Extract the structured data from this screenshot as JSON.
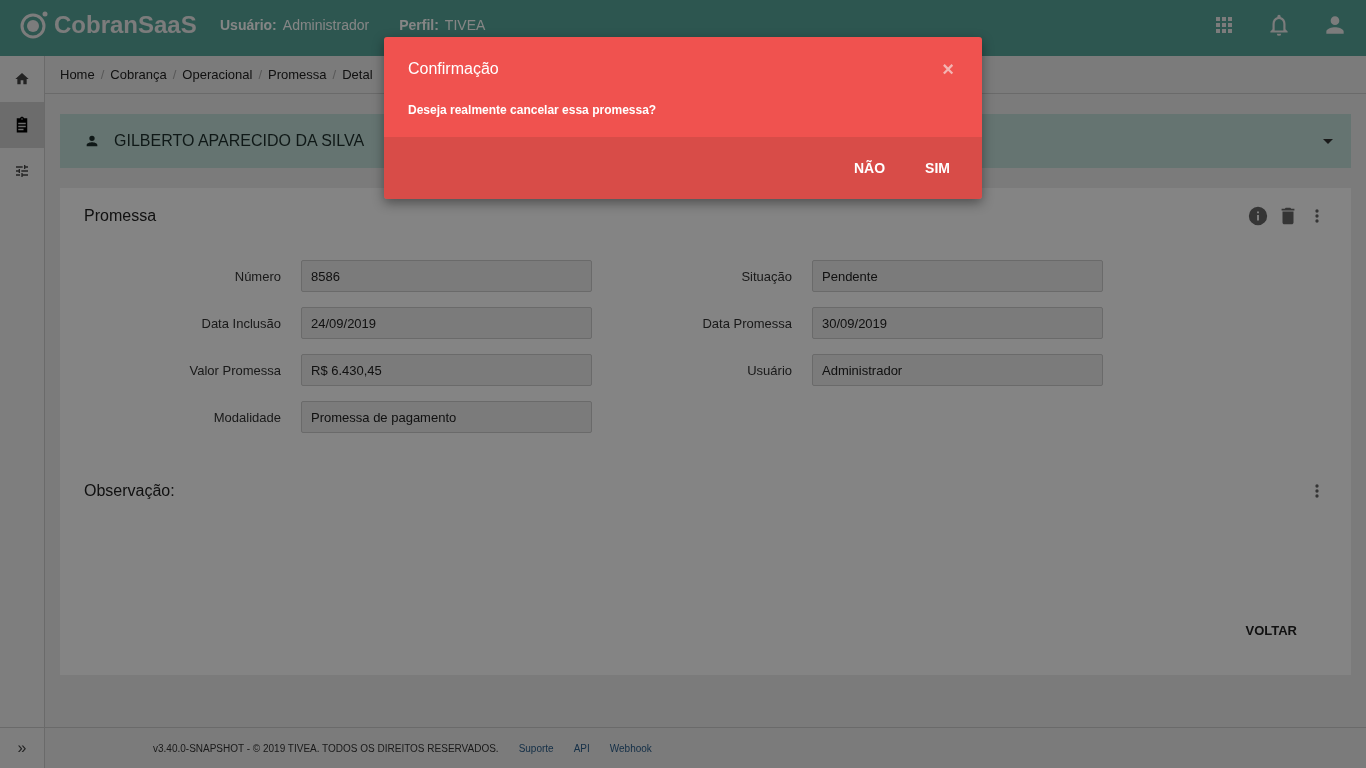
{
  "header": {
    "logo": "CobranSaaS",
    "user_label": "Usuário:",
    "user_value": "Administrador",
    "profile_label": "Perfil:",
    "profile_value": "TIVEA"
  },
  "breadcrumb": {
    "separator": "/",
    "items": [
      "Home",
      "Cobrança",
      "Operacional",
      "Promessa",
      "Detal"
    ]
  },
  "sidebar": {
    "items": [
      {
        "kind": "home",
        "selected": false
      },
      {
        "kind": "clipboard",
        "selected": true
      },
      {
        "kind": "tune",
        "selected": false
      }
    ],
    "expand": "»"
  },
  "client": {
    "name": "GILBERTO APARECIDO DA SILVA",
    "expanded": false
  },
  "card": {
    "title": "Promessa",
    "fields_left": [
      {
        "label": "Número",
        "value": "8586"
      },
      {
        "label": "Data Inclusão",
        "value": "24/09/2019"
      },
      {
        "label": "Valor Promessa",
        "value": "R$ 6.430,45"
      },
      {
        "label": "Modalidade",
        "value": "Promessa de pagamento"
      }
    ],
    "fields_right": [
      {
        "label": "Situação",
        "value": "Pendente"
      },
      {
        "label": "Data Promessa",
        "value": "30/09/2019"
      },
      {
        "label": "Usuário",
        "value": "Administrador"
      }
    ],
    "observation_title": "Observação:",
    "back_button": "VOLTAR"
  },
  "footer": {
    "copyright": "v3.40.0-SNAPSHOT - © 2019 TIVEA. TODOS OS DIREITOS RESERVADOS.",
    "links": [
      "Suporte",
      "API",
      "Webhook"
    ]
  },
  "modal": {
    "title": "Confirmação",
    "close": "×",
    "message": "Deseja realmente cancelar essa promessa?",
    "buttons": [
      "NÃO",
      "SIM"
    ]
  }
}
